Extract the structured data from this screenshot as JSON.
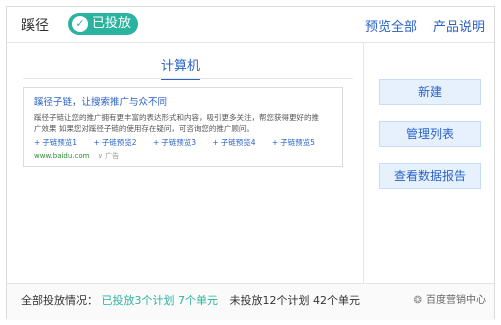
{
  "header": {
    "title": "蹊径",
    "status_label": "已投放",
    "preview_all": "预览全部",
    "product_info": "产品说明"
  },
  "tab": {
    "label": "计算机"
  },
  "ad": {
    "title": "蹊径子链，让搜索推广与众不同",
    "desc": "蹊径子链让您的推广拥有更丰富的表达形式和内容，吸引更多关注，帮您获得更好的推广效果 如果您对蹊径子链的使用存在疑问，可咨询您的推广顾问。",
    "links": [
      "子链预览1",
      "子链预览2",
      "子链预览3",
      "子链预览4",
      "子链预览5"
    ],
    "url": "www.baidu.com",
    "tag": "广告"
  },
  "side_buttons": {
    "new": "新建",
    "manage": "管理列表",
    "report": "查看数据报告"
  },
  "footer": {
    "label": "全部投放情况：",
    "active": "已投放3个计划 7个单元",
    "inactive": "未投放12个计划 42个单元",
    "watermark": "百度营销中心"
  },
  "colors": {
    "accent": "#2a62c8",
    "status": "#2cb3a0"
  }
}
